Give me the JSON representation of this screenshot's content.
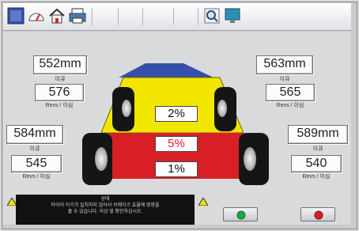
{
  "colors": {
    "accent_red": "#d81f26",
    "accent_yellow": "#f2e600",
    "accent_blue": "#3550a8",
    "go_green": "#1aa84a"
  },
  "toolbar": {
    "icons": [
      "stop-icon",
      "gauge-icon",
      "home-icon",
      "printer-icon",
      "print-preview-icon",
      "monitor-icon"
    ]
  },
  "readings": {
    "front_left": {
      "value": "552mm",
      "unit_label": "이큐"
    },
    "front_right": {
      "value": "563mm",
      "unit_label": "이큐"
    },
    "rear_left": {
      "value": "584mm",
      "unit_label": "이큐"
    },
    "rear_right": {
      "value": "589mm",
      "unit_label": "이큐"
    },
    "front_left_revs": {
      "value": "576",
      "label": "Revs / 이심"
    },
    "front_right_revs": {
      "value": "565",
      "label": "Revs / 이심"
    },
    "rear_left_revs": {
      "value": "545",
      "label": "Revs / 이심"
    },
    "rear_right_revs": {
      "value": "540",
      "label": "Revs / 이심"
    }
  },
  "percentages": {
    "front": "2%",
    "middle": "5%",
    "rear": "1%"
  },
  "message": {
    "title": "상태",
    "line1": "타이어 이기가 일치하지 않아서 브레이크 효율에 영향을",
    "line2": "줄 수 있습니다. 이상 및 확인하십시오."
  }
}
